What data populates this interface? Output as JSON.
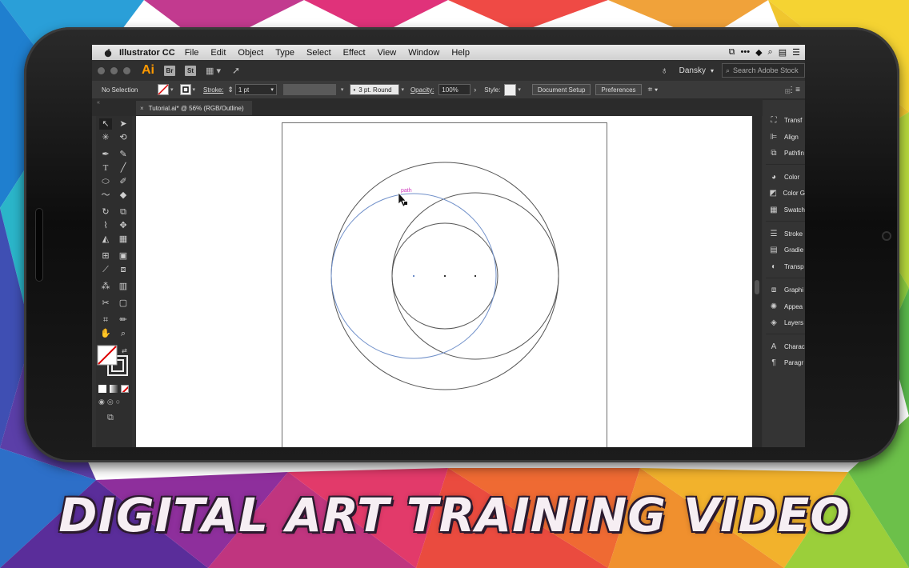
{
  "menubar": {
    "app_name": "Illustrator CC",
    "items": [
      "File",
      "Edit",
      "Object",
      "Type",
      "Select",
      "Effect",
      "View",
      "Window",
      "Help"
    ]
  },
  "appbar": {
    "logo": "Ai",
    "bridge": "Br",
    "stock": "St",
    "user": "Dansky",
    "search_placeholder": "Search Adobe Stock"
  },
  "control": {
    "selection": "No Selection",
    "stroke_label": "Stroke:",
    "stroke_value": "1 pt",
    "brush": "3 pt. Round",
    "opacity_label": "Opacity:",
    "opacity_value": "100%",
    "style_label": "Style:",
    "document_setup": "Document Setup",
    "preferences": "Preferences"
  },
  "document_tab": {
    "close": "×",
    "title": "Tutorial.ai* @ 56% (RGB/Outline)"
  },
  "canvas": {
    "hover_label": "path"
  },
  "panels": {
    "items": [
      "Transf",
      "Align",
      "Pathfin",
      "Color",
      "Color G",
      "Swatch",
      "Stroke",
      "Gradie",
      "Transp",
      "Graphi",
      "Appea",
      "Layers",
      "Charac",
      "Paragr"
    ]
  },
  "banner": {
    "text": "DIGITAL ART TRAINING VIDEO"
  },
  "colors": {
    "ai_orange": "#ff9a00",
    "path_blue": "#6f8fc9",
    "path_label_magenta": "#d040c0"
  }
}
